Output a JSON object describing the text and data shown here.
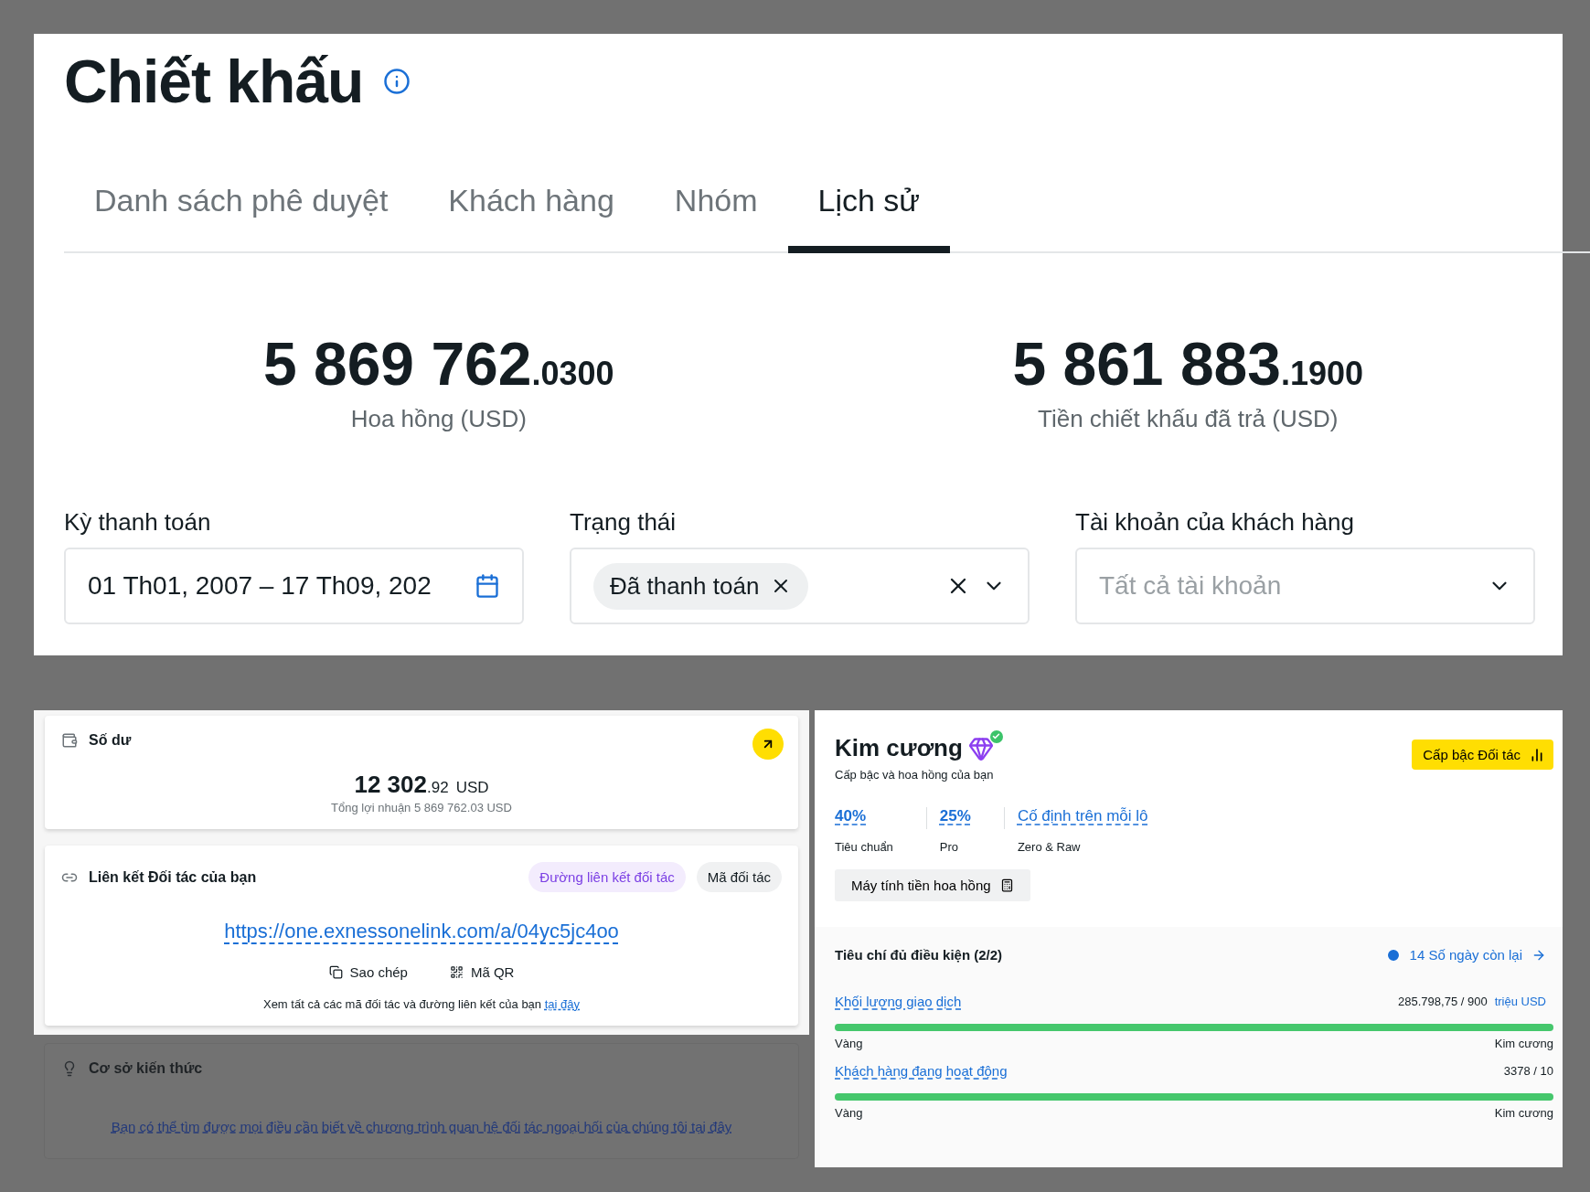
{
  "header": {
    "title": "Chiết khấu"
  },
  "tabs": [
    {
      "label": "Danh sách phê duyệt",
      "selected": false
    },
    {
      "label": "Khách hàng",
      "selected": false
    },
    {
      "label": "Nhóm",
      "selected": false
    },
    {
      "label": "Lịch sử",
      "selected": true
    }
  ],
  "stats": [
    {
      "integer": "5 869 762",
      "decimal": ".0300",
      "label": "Hoa hồng (USD)"
    },
    {
      "integer": "5 861 883",
      "decimal": ".1900",
      "label": "Tiền chiết khấu đã trả (USD)"
    }
  ],
  "filters": [
    {
      "label": "Kỳ thanh toán",
      "kind": "date",
      "value": "01 Th01, 2007 – 17 Th09, 202"
    },
    {
      "label": "Trạng thái",
      "kind": "tags",
      "tags": [
        "Đã thanh toán"
      ]
    },
    {
      "label": "Tài khoản của khách hàng",
      "kind": "select",
      "placeholder": "Tất cả tài khoản"
    }
  ],
  "balance": {
    "title": "Số dư",
    "integer": "12 302",
    "decimal": ".92",
    "currency": "USD",
    "subtitle": "Tổng lợi nhuận 5 869 762.03 USD"
  },
  "partner_link": {
    "title": "Liên kết Đối tác của bạn",
    "options": [
      {
        "label": "Đường liên kết đối tác",
        "selected": true
      },
      {
        "label": "Mã đối tác",
        "selected": false
      }
    ],
    "url": "https://one.exnessonelink.com/a/04yc5jc4oo",
    "actions": [
      {
        "label": "Sao chép",
        "kind": "copy"
      },
      {
        "label": "Mã QR",
        "kind": "qr"
      }
    ],
    "note": "Xem tất cả các mã đối tác và đường liên kết của bạn",
    "note_link": "tại đây"
  },
  "knowledge": {
    "title": "Cơ sở kiến thức",
    "link": "Bạn có thể tìm được mọi điều cần biết về chương trình quan hệ đối tác ngoại hối của chúng tôi tại đây"
  },
  "tier": {
    "name": "Kim cương",
    "verified": true,
    "subtitle": "Cấp bậc và hoa hồng của bạn",
    "button": "Cấp bậc Đối tác",
    "rates": [
      {
        "value": "40%",
        "label": "Tiêu chuẩn"
      },
      {
        "value": "25%",
        "label": "Pro"
      },
      {
        "value": "Cố định trên mỗi lô",
        "label": "Zero & Raw"
      }
    ],
    "calculator": "Máy tính tiền hoa hồng"
  },
  "criteria": {
    "title": "Tiêu chí đủ điều kiện (2/2)",
    "days_left": "14 Số ngày còn lại",
    "items": [
      {
        "name": "Khối lượng giao dịch",
        "progress": "285.798,75 / 900",
        "unit": "triệu USD",
        "level": 1,
        "from": "Vàng",
        "to": "Kim cương"
      },
      {
        "name": "Khách hàng đang hoạt động",
        "progress": "3378 / 10",
        "level": 1,
        "from": "Vàng",
        "to": "Kim cương"
      }
    ]
  }
}
